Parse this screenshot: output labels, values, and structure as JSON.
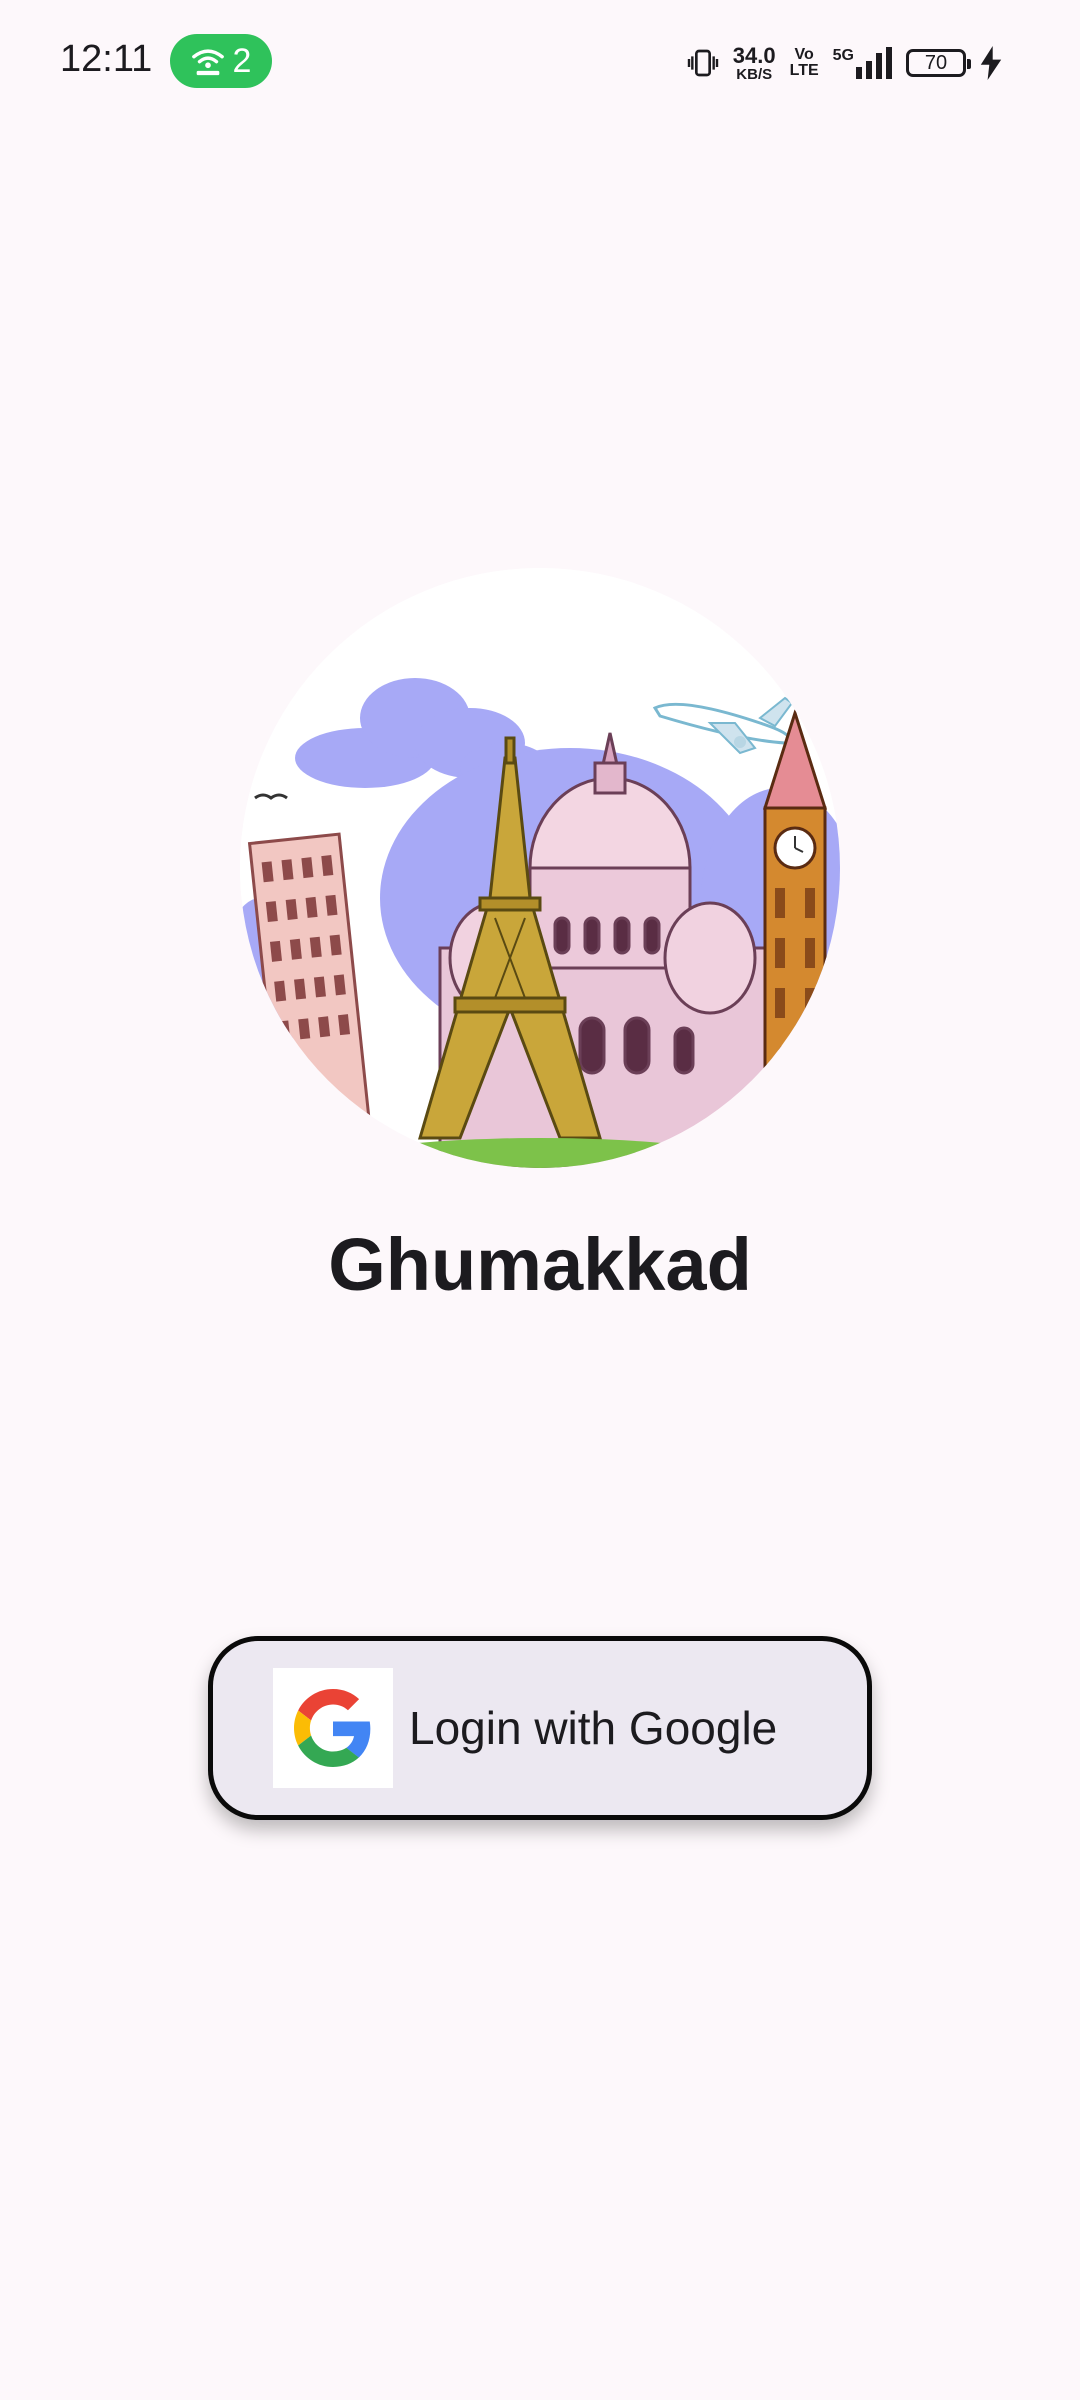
{
  "status_bar": {
    "time": "12:11",
    "hotspot_count": "2",
    "net_speed_value": "34.0",
    "net_speed_unit": "KB/S",
    "volte_top": "Vo",
    "volte_bottom": "LTE",
    "network_type": "5G",
    "battery_level": "70"
  },
  "app": {
    "title": "Ghumakkad"
  },
  "login": {
    "label": "Login with Google"
  },
  "colors": {
    "background": "#fdf8fb",
    "button_fill": "#ece8f1",
    "button_border": "#0a0a0a",
    "hotspot_green": "#2fc25b"
  },
  "icons": {
    "hotspot": "hotspot-icon",
    "vibrate": "vibrate-icon",
    "signal": "signal-icon",
    "battery": "battery-icon",
    "charging": "charging-icon",
    "google": "google-g-icon"
  }
}
